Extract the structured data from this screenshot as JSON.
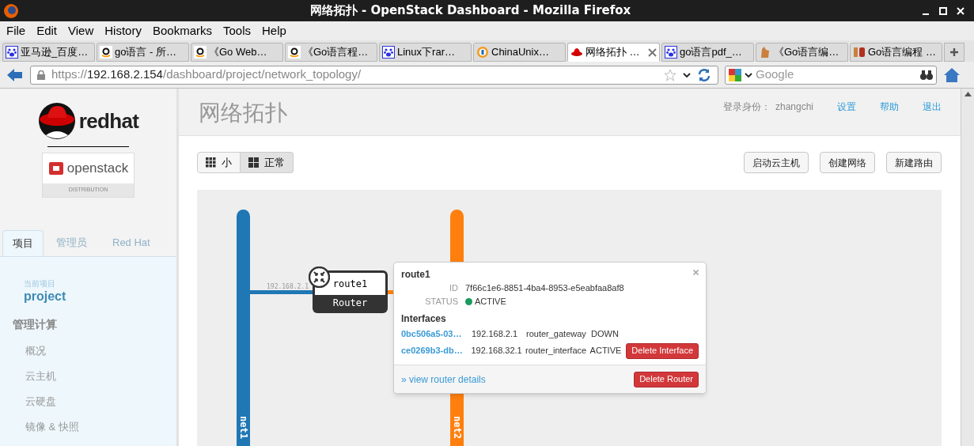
{
  "window": {
    "title": "网络拓扑 - OpenStack Dashboard - Mozilla Firefox"
  },
  "menu": [
    "File",
    "Edit",
    "View",
    "History",
    "Bookmarks",
    "Tools",
    "Help"
  ],
  "browser_tabs": [
    {
      "label": "亚马逊_百度…",
      "kind": "paw",
      "selected": false
    },
    {
      "label": "go语言 - 所…",
      "kind": "amazon",
      "selected": false
    },
    {
      "label": "《Go Web…",
      "kind": "amazon",
      "selected": false
    },
    {
      "label": "《Go语言程…",
      "kind": "amazon",
      "selected": false
    },
    {
      "label": "Linux下rar…",
      "kind": "paw",
      "selected": false
    },
    {
      "label": "ChinaUnix…",
      "kind": "unix",
      "selected": false
    },
    {
      "label": "网络拓扑 …",
      "kind": "redhat",
      "selected": true
    },
    {
      "label": "go语言pdf_…",
      "kind": "paw",
      "selected": false
    },
    {
      "label": "《Go语言编…",
      "kind": "cat",
      "selected": false
    },
    {
      "label": "Go语言编程 …",
      "kind": "jb",
      "selected": false
    }
  ],
  "address": {
    "scheme": "https://",
    "host": "192.168.2.154",
    "path": "/dashboard/project/network_topology/"
  },
  "search": {
    "placeholder": "Google"
  },
  "sidebar": {
    "logo_word": "redhat",
    "product_word": "openstack",
    "product_sub": "DISTRIBUTION",
    "tabs": [
      {
        "label": "项目",
        "selected": true
      },
      {
        "label": "管理员",
        "selected": false
      },
      {
        "label": "Red Hat",
        "selected": false
      }
    ],
    "current_label": "当前项目",
    "project": "project",
    "section": "管理计算",
    "items": [
      "概况",
      "云主机",
      "云硬盘",
      "镜像 & 快照"
    ]
  },
  "header": {
    "title": "网络拓扑",
    "user_label": "登录身份：",
    "username": "zhangchi",
    "links": [
      "设置",
      "帮助",
      "退出"
    ]
  },
  "view_toggle": [
    {
      "label": "小",
      "selected": false
    },
    {
      "label": "正常",
      "selected": true
    }
  ],
  "actions": [
    "启动云主机",
    "创建网络",
    "新建路由"
  ],
  "topology": {
    "networks": [
      {
        "name": "net1",
        "color": "#1f77b4"
      },
      {
        "name": "net2",
        "color": "#ff7f0e"
      }
    ],
    "link_ip": "192.168.2.1",
    "router": {
      "name": "route1",
      "type": "Router"
    },
    "popup": {
      "title": "route1",
      "fields": [
        {
          "label": "ID",
          "value": "7f66c1e6-8851-4ba4-8953-e5eabfaa8af8",
          "kind": "text"
        },
        {
          "label": "STATUS",
          "value": "ACTIVE",
          "kind": "status"
        }
      ],
      "interfaces_heading": "Interfaces",
      "interfaces": [
        {
          "id": "0bc506a5-03…",
          "ip": "192.168.2.1",
          "type": "router_gateway",
          "status": "DOWN"
        },
        {
          "id": "ce0269b3-db…",
          "ip": "192.168.32.1",
          "type": "router_interface",
          "status": "ACTIVE",
          "action": "Delete Interface"
        }
      ],
      "details_link": "» view router details",
      "delete_button": "Delete Router"
    }
  }
}
